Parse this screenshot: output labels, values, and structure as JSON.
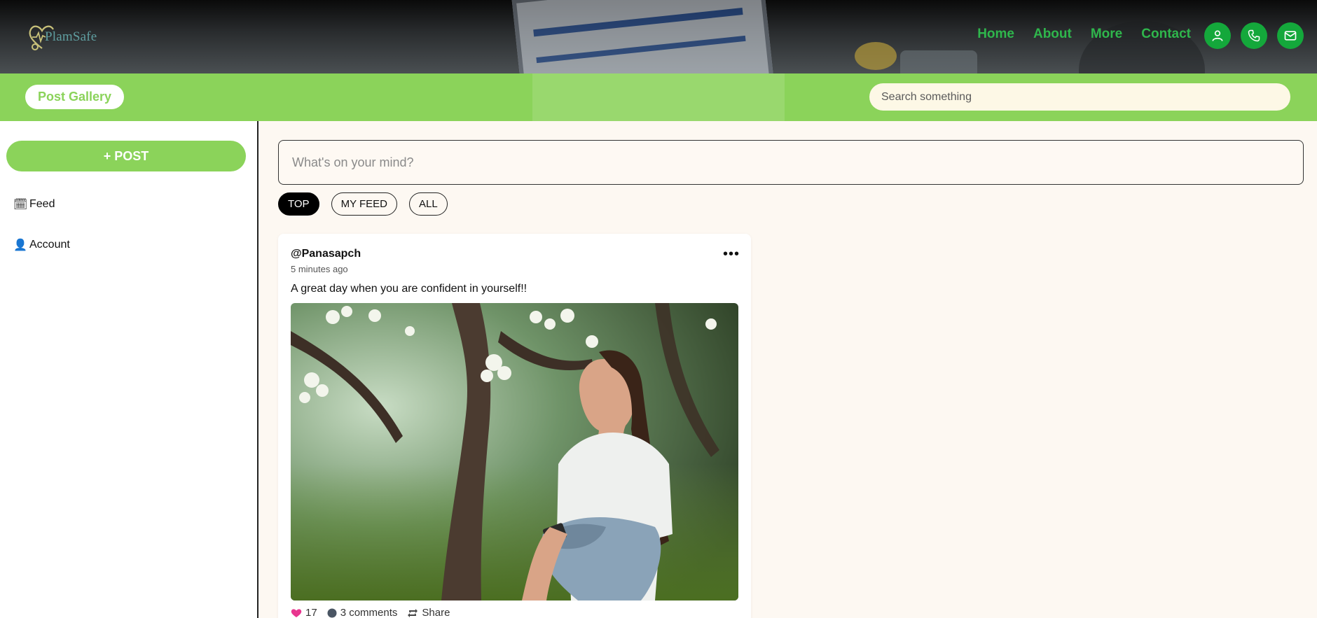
{
  "brand": {
    "name": "PlamSafe",
    "color": "#2fb64c"
  },
  "nav": {
    "home": "Home",
    "about": "About",
    "more": "More",
    "contact": "Contact"
  },
  "header_icons": [
    "user-icon",
    "phone-icon",
    "mail-icon"
  ],
  "subbar": {
    "title": "Post Gallery",
    "search_placeholder": "Search something",
    "color": "#8bd35a"
  },
  "sidebar": {
    "post_button": "+ POST",
    "items": [
      {
        "label": "Feed",
        "icon": "🗓"
      },
      {
        "label": "Account",
        "icon": "👤"
      }
    ]
  },
  "composer": {
    "placeholder": "What's on your mind?"
  },
  "tabs": [
    {
      "label": "TOP",
      "active": true
    },
    {
      "label": "MY FEED",
      "active": false
    },
    {
      "label": "ALL",
      "active": false
    }
  ],
  "post": {
    "author": "@Panasapch",
    "time": "5 minutes ago",
    "caption": "A great day when you are confident in yourself!!",
    "likes": "17",
    "comments": "3 comments",
    "share": "Share"
  }
}
